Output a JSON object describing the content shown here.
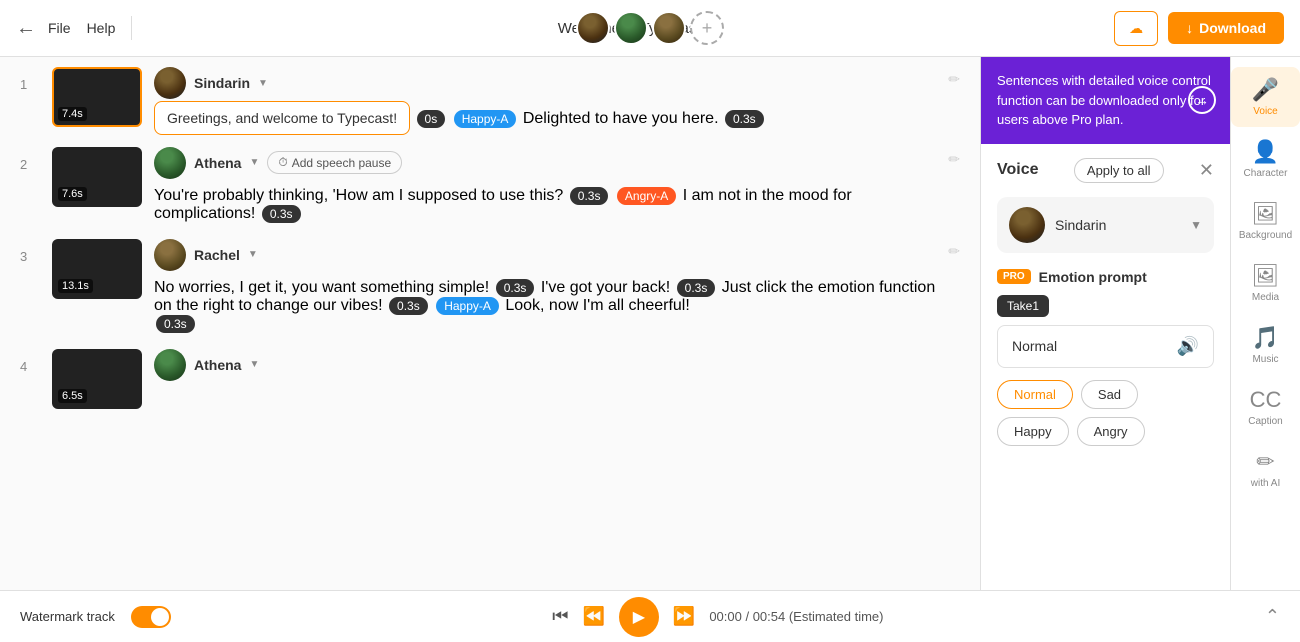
{
  "topbar": {
    "back_icon": "←",
    "file_label": "File",
    "help_label": "Help",
    "title": "Welcome to Typecast!",
    "upload_icon": "↑",
    "upload_label": "",
    "download_icon": "↓",
    "download_label": "Download"
  },
  "proBanner": {
    "text": "Sentences with detailed voice control function can be downloaded only for users above Pro plan.",
    "arrow": "→"
  },
  "voicePanel": {
    "title": "Voice",
    "apply_all": "Apply to all",
    "close": "✕",
    "speaker_name": "Sindarin",
    "speaker_caret": "▼",
    "pro_badge": "PRO",
    "emotion_title": "Emotion prompt",
    "take_label": "Take1",
    "emotion_selected": "Normal",
    "speaker_icon": "🔊",
    "emotion_buttons": [
      "Normal",
      "Sad",
      "Happy",
      "Angry"
    ]
  },
  "iconSidebar": {
    "items": [
      {
        "id": "voice",
        "sym": "🎤",
        "label": "Voice",
        "active": true
      },
      {
        "id": "character",
        "sym": "👤",
        "label": "Character",
        "active": false
      },
      {
        "id": "background",
        "sym": "🖼",
        "label": "Background",
        "active": false
      },
      {
        "id": "media",
        "sym": "🖼",
        "label": "Media",
        "active": false
      },
      {
        "id": "music",
        "sym": "🎵",
        "label": "Music",
        "active": false
      },
      {
        "id": "caption",
        "sym": "CC",
        "label": "Caption",
        "active": false
      },
      {
        "id": "withai",
        "sym": "✏",
        "label": "with AI",
        "active": false
      }
    ]
  },
  "scripts": [
    {
      "num": "1",
      "thumb_time": "7.4s",
      "speaker": "Sindarin",
      "speaker_caret": "▼",
      "text_bordered": "Greetings, and welcome to Typecast!",
      "pause1": "0s",
      "emotion1": "Happy-A",
      "text2": "Delighted to have you here.",
      "pause2": "0.3s",
      "has_add_pause": false
    },
    {
      "num": "2",
      "thumb_time": "7.6s",
      "speaker": "Athena",
      "speaker_caret": "▼",
      "add_pause_label": "Add speech pause",
      "pause1": "0.3s",
      "emotion1": "Angry-A",
      "text1": "You're probably thinking, 'How am I supposed to use this?",
      "text2": "I am not in the mood for complications!",
      "pause2": "0.3s",
      "has_add_pause": true
    },
    {
      "num": "3",
      "thumb_time": "13.1s",
      "speaker": "Rachel",
      "speaker_caret": "▼",
      "text1": "No worries, I get it, you want something simple!",
      "pause1": "0.3s",
      "text2": "I've got your back!",
      "pause2": "0.3s",
      "text3": "Just click the emotion function on the right to change our vibes!",
      "pause3": "0.3s",
      "emotion1": "Happy-A",
      "text4": "Look, now I'm all cheerful!",
      "pause4": "0.3s",
      "has_add_pause": false
    },
    {
      "num": "4",
      "thumb_time": "6.5s",
      "speaker": "Athena",
      "speaker_caret": "▼",
      "has_add_pause": false
    }
  ],
  "bottomBar": {
    "watermark_label": "Watermark track",
    "time_display": "00:00 / 00:54 (Estimated time)",
    "expand_icon": "⌃"
  }
}
